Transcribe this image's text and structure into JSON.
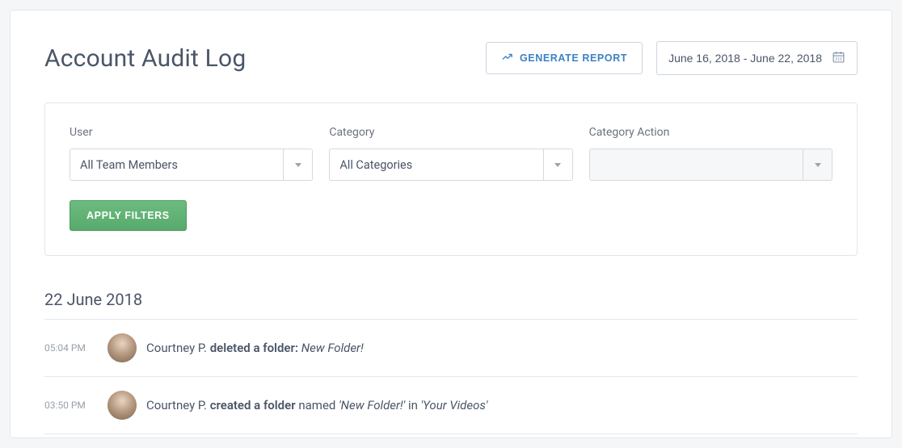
{
  "header": {
    "title": "Account Audit Log",
    "generate_report_label": "GENERATE REPORT",
    "date_range": "June 16, 2018 - June 22, 2018"
  },
  "filters": {
    "user": {
      "label": "User",
      "value": "All Team Members"
    },
    "category": {
      "label": "Category",
      "value": "All Categories"
    },
    "category_action": {
      "label": "Category Action",
      "value": ""
    },
    "apply_label": "APPLY FILTERS"
  },
  "log": {
    "date_heading": "22 June 2018",
    "entries": [
      {
        "time": "05:04 PM",
        "actor": "Courtney P.",
        "action": "deleted a folder:",
        "target": "New Folder!"
      },
      {
        "time": "03:50 PM",
        "actor": "Courtney P.",
        "action": "created a folder",
        "middle": "named",
        "target": "'New Folder!'",
        "preposition": "in",
        "location": "'Your Videos'"
      }
    ]
  }
}
